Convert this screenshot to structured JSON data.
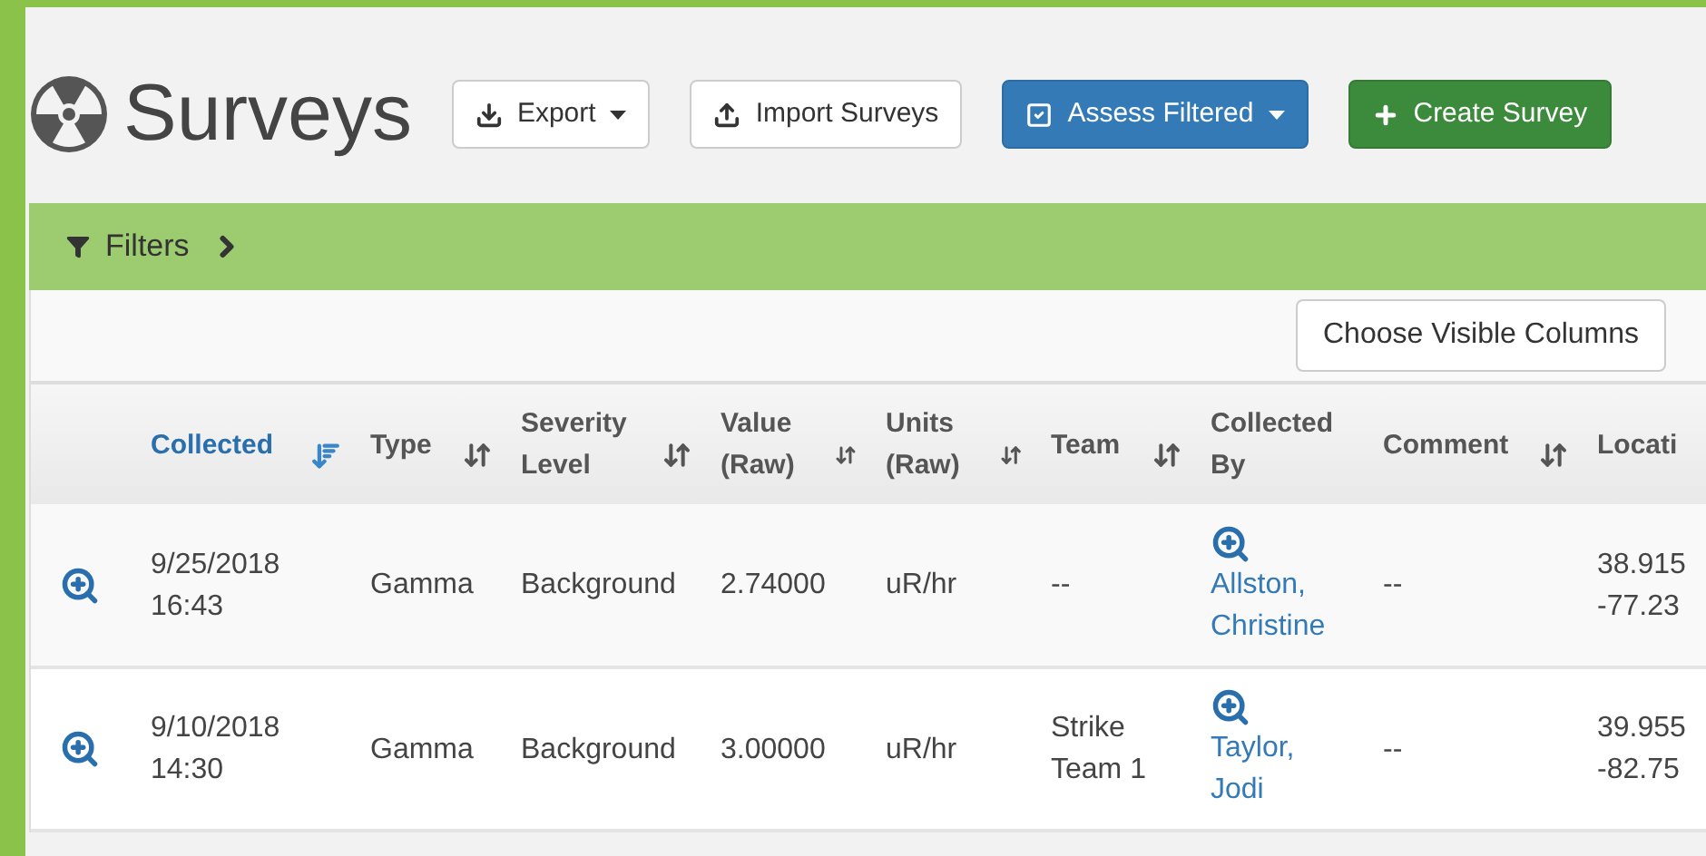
{
  "page": {
    "title": "Surveys"
  },
  "toolbar": [
    {
      "kind": "export",
      "label": "Export",
      "dropdown": true
    },
    {
      "kind": "import",
      "label": "Import Surveys",
      "dropdown": false
    },
    {
      "kind": "assess",
      "label": "Assess Filtered",
      "dropdown": true
    },
    {
      "kind": "create",
      "label": "Create Survey",
      "dropdown": false
    }
  ],
  "filters": {
    "label": "Filters",
    "expanded": false
  },
  "choose_columns_button": "Choose Visible Columns",
  "table": {
    "columns": [
      {
        "label": "Collected",
        "sortable": true,
        "sorted": true
      },
      {
        "label": "Type",
        "sortable": true,
        "sorted": false
      },
      {
        "label": "Severity Level",
        "sortable": true,
        "sorted": false
      },
      {
        "label": "Value (Raw)",
        "sortable": true,
        "sorted": false
      },
      {
        "label": "Units (Raw)",
        "sortable": true,
        "sorted": false
      },
      {
        "label": "Team",
        "sortable": true,
        "sorted": false
      },
      {
        "label": "Collected By",
        "sortable": false,
        "sorted": false
      },
      {
        "label": "Comment",
        "sortable": true,
        "sorted": false
      },
      {
        "label": "Locati",
        "sortable": false,
        "sorted": false
      }
    ],
    "rows": [
      {
        "cells": [
          "9/25/2018 16:43",
          "Gamma",
          "Background",
          "2.74000",
          "uR/hr",
          "--",
          "Allston, Christine",
          "--",
          "38.915\n-77.23"
        ]
      },
      {
        "cells": [
          "9/10/2018 14:30",
          "Gamma",
          "Background",
          "3.00000",
          "uR/hr",
          "Strike Team 1",
          "Taylor, Jodi",
          "--",
          "39.955\n-82.75"
        ]
      }
    ]
  }
}
